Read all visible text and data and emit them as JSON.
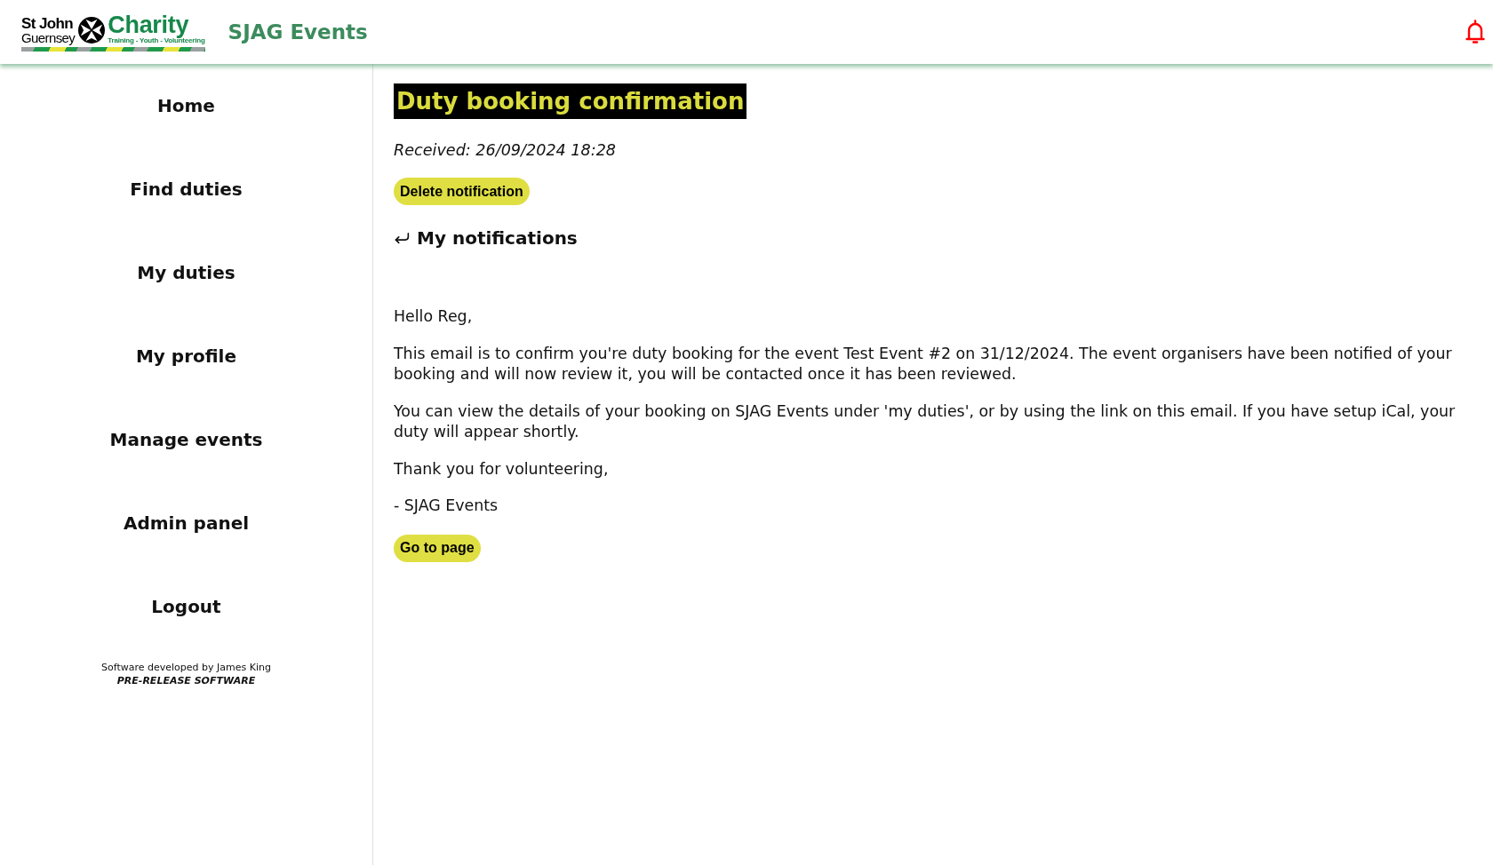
{
  "header": {
    "logo": {
      "lines": [
        "St John",
        "Guernsey"
      ],
      "name": "Charity",
      "tagline": "Training - Youth - Volunteering"
    },
    "app_title": "SJAG Events"
  },
  "sidebar": {
    "items": [
      "Home",
      "Find duties",
      "My duties",
      "My profile",
      "Manage events",
      "Admin panel",
      "Logout"
    ],
    "footer": {
      "credit": "Software developed by James King",
      "notice": "PRE-RELEASE SOFTWARE"
    }
  },
  "notification": {
    "title": "Duty booking confirmation",
    "received": "Received: 26/09/2024 18:28",
    "delete_button": "Delete notification",
    "back_link": "My notifications",
    "paragraphs": [
      "Hello Reg,",
      "This email is to confirm you're duty booking for the event Test Event #2 on 31/12/2024. The event organisers have been notified of your booking and will now review it, you will be contacted once it has been reviewed.",
      "You can view the details of your booking on SJAG Events under 'my duties', or by using the link on this email. If you have setup iCal, your duty will appear shortly.",
      "Thank you for volunteering,",
      "- SJAG Events"
    ],
    "go_button": "Go to page"
  }
}
